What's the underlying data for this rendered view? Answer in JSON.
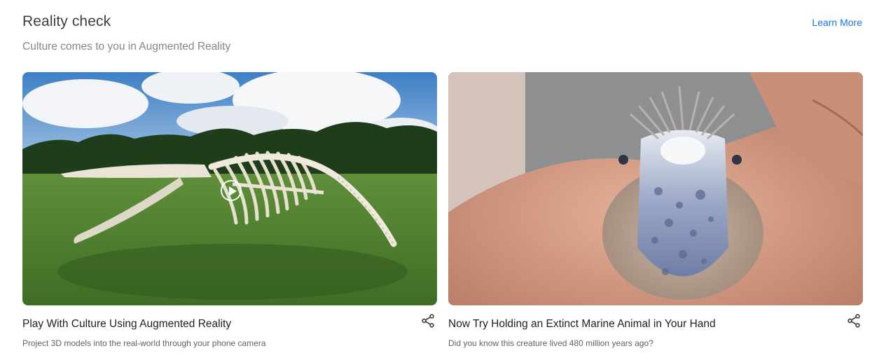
{
  "section": {
    "title": "Reality check",
    "subtitle": "Culture comes to you in Augmented Reality",
    "learn_more": "Learn More"
  },
  "cards": [
    {
      "title": "Play With Culture Using Augmented Reality",
      "description": "Project 3D models into the real-world through your phone camera",
      "image": "whale-skeleton-on-grass-field",
      "icon": "play-icon",
      "share_icon": "share-icon"
    },
    {
      "title": "Now Try Holding an Extinct Marine Animal in Your Hand",
      "description": "Did you know this creature lived 480 million years ago?",
      "image": "extinct-marine-animal-in-hand",
      "share_icon": "share-icon"
    }
  ],
  "colors": {
    "link": "#1a73e8",
    "title": "#3c4043",
    "subtitle": "#80868b"
  }
}
